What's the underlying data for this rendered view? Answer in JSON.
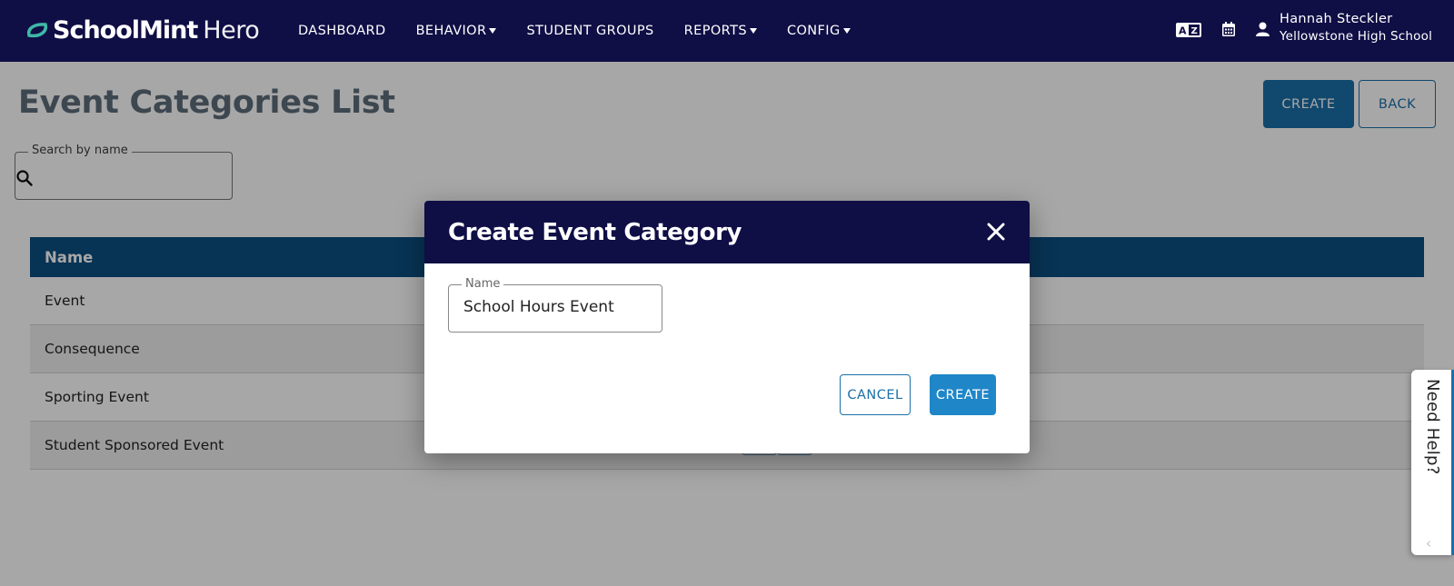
{
  "header": {
    "logo_bold": "SchoolMint",
    "logo_light": "Hero",
    "nav": [
      {
        "label": "DASHBOARD"
      },
      {
        "label": "BEHAVIOR"
      },
      {
        "label": "STUDENT GROUPS"
      },
      {
        "label": "REPORTS"
      },
      {
        "label": "CONFIG"
      }
    ],
    "icons": [
      "translate-icon",
      "calendar-icon",
      "user-icon"
    ],
    "user_name": "Hannah Steckler",
    "user_school": "Yellowstone High School"
  },
  "page": {
    "title": "Event Categories List",
    "create_label": "CREATE",
    "back_label": "BACK",
    "search_label": "Search by name",
    "search_value": ""
  },
  "table": {
    "header": "Name",
    "rows": [
      {
        "name": "Event"
      },
      {
        "name": "Consequence"
      },
      {
        "name": "Sporting Event"
      },
      {
        "name": "Student Sponsored Event"
      }
    ]
  },
  "modal": {
    "title": "Create Event Category",
    "name_label": "Name",
    "name_value": "School Hours Event",
    "cancel_label": "CANCEL",
    "create_label": "CREATE"
  },
  "help": {
    "label": "Need Help?"
  },
  "colors": {
    "nav_bg": "#0f0e45",
    "accent": "#1f86c8",
    "table_header": "#0c4f80"
  }
}
